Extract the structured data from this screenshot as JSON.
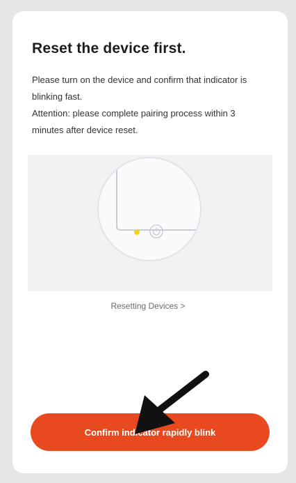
{
  "page": {
    "title": "Reset the device first.",
    "description_line1": "Please turn on the device and confirm that indicator is blinking fast.",
    "description_line2": "Attention: please complete pairing process within 3 minutes after device reset."
  },
  "illustration": {
    "led_color": "#f5d21f",
    "icon": "power-icon"
  },
  "links": {
    "resetting_devices": "Resetting Devices >"
  },
  "actions": {
    "confirm_label": "Confirm indicator rapidly blink",
    "accent_color": "#e8491f"
  },
  "annotation": {
    "icon": "arrow-icon",
    "color": "#111111"
  }
}
